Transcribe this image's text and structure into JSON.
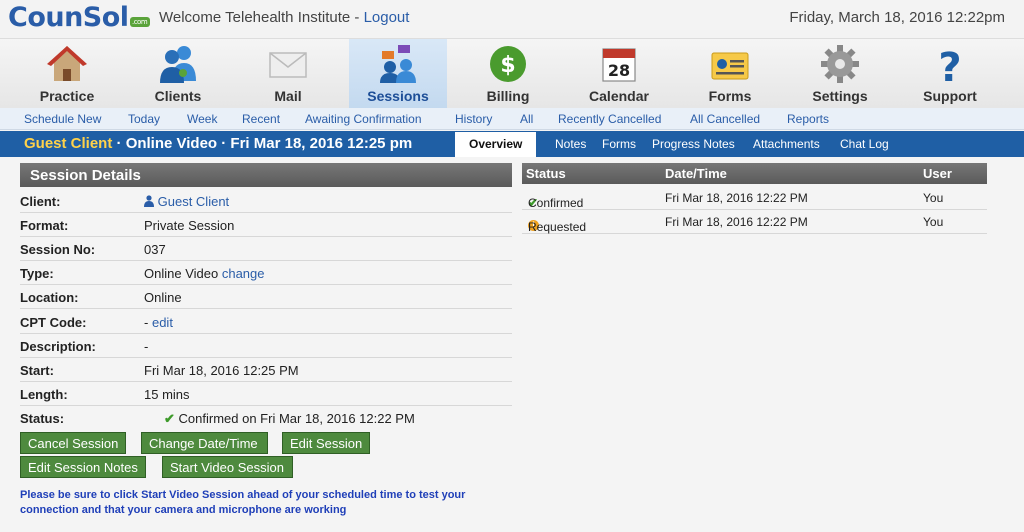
{
  "header": {
    "logo": "CounSol",
    "logo_badge": ".com",
    "welcome": "Welcome Telehealth Institute -",
    "logout": "Logout",
    "datetime": "Friday, March 18, 2016  12:22pm"
  },
  "main_nav": [
    {
      "label": "Practice",
      "icon": "house-icon"
    },
    {
      "label": "Clients",
      "icon": "people-icon"
    },
    {
      "label": "Mail",
      "icon": "envelope-icon"
    },
    {
      "label": "Sessions",
      "icon": "sessions-icon",
      "active": true
    },
    {
      "label": "Billing",
      "icon": "dollar-icon"
    },
    {
      "label": "Calendar",
      "icon": "calendar-icon",
      "calendar_day": "28"
    },
    {
      "label": "Forms",
      "icon": "id-card-icon"
    },
    {
      "label": "Settings",
      "icon": "gear-icon"
    },
    {
      "label": "Support",
      "icon": "question-icon"
    }
  ],
  "sub_nav": [
    "Schedule New",
    "Today",
    "Week",
    "Recent",
    "Awaiting Confirmation",
    "History",
    "All",
    "Recently Cancelled",
    "All Cancelled",
    "Reports"
  ],
  "context": {
    "client": "Guest Client",
    "rest": " · Online Video · Fri Mar 18, 2016 12:25 pm",
    "tabs": [
      "Overview",
      "Notes",
      "Forms",
      "Progress Notes",
      "Attachments",
      "Chat Log"
    ],
    "active_tab": "Overview"
  },
  "session_details": {
    "title": "Session Details",
    "client_label": "Client:",
    "client_value": "Guest Client",
    "format_label": "Format:",
    "format_value": "Private Session",
    "session_no_label": "Session No:",
    "session_no_value": "037",
    "type_label": "Type:",
    "type_value": "Online Video",
    "type_link": "change",
    "location_label": "Location:",
    "location_value": "Online",
    "cpt_label": "CPT Code:",
    "cpt_value": "-",
    "cpt_link": "edit",
    "description_label": "Description:",
    "description_value": "-",
    "start_label": "Start:",
    "start_value": "Fri Mar 18, 2016 12:25 PM",
    "length_label": "Length:",
    "length_value": "15 mins",
    "status_label": "Status:",
    "status_value": "Confirmed on Fri Mar 18, 2016 12:22 PM"
  },
  "buttons": {
    "cancel": "Cancel Session",
    "change": "Change Date/Time",
    "edit": "Edit Session",
    "edit_notes": "Edit Session Notes",
    "start_video": "Start Video Session"
  },
  "notice": "Please be sure to click Start Video Session ahead of your scheduled time to test your connection and that your camera and microphone are working",
  "status_table": {
    "headers": [
      "Status",
      "Date/Time",
      "User"
    ],
    "rows": [
      {
        "status": "Confirmed",
        "icon": "check-icon",
        "datetime": "Fri Mar 18, 2016 12:22 PM",
        "user": "You"
      },
      {
        "status": "Requested",
        "icon": "warning-icon",
        "datetime": "Fri Mar 18, 2016 12:22 PM",
        "user": "You"
      }
    ]
  },
  "colors": {
    "brand_blue": "#2a5da8",
    "context_bar": "#1f5fa5",
    "button_green": "#4e8a3e",
    "client_yellow": "#ffd24a"
  }
}
